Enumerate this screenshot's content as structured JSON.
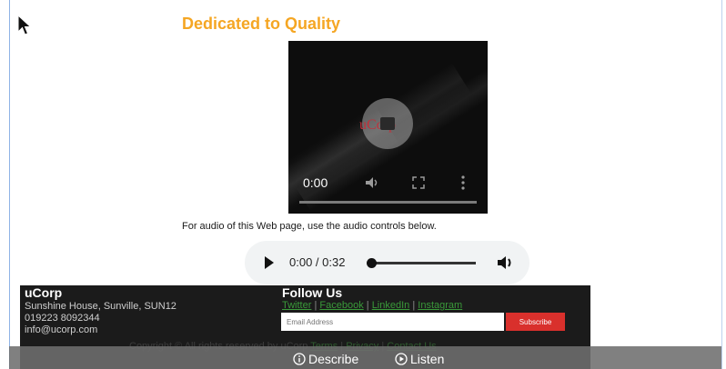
{
  "page": {
    "heading": "Dedicated to Quality",
    "audio_note": "For audio of this Web page, use the audio controls below."
  },
  "video": {
    "logo_text": "uCorp",
    "time": "0:00"
  },
  "audio_player": {
    "time": "0:00 / 0:32",
    "progress": 0
  },
  "footer": {
    "company_name": "uCorp",
    "address_lines": [
      "Sunshine House, Sunville, SUN12",
      "019223 8092344",
      "info@ucorp.com"
    ],
    "follow_title": "Follow Us",
    "social_links": [
      "Twitter",
      "Facebook",
      "LinkedIn",
      "Instagram"
    ],
    "separator": "|",
    "email_placeholder": "Email Address",
    "subscribe_label": "Subscribe",
    "copyright_text": "Copyright © All rights reserved by uCorp",
    "legal_links": [
      "Terms",
      "Privacy",
      "Contact Us"
    ]
  },
  "accessibility_bar": {
    "describe_label": "Describe",
    "listen_label": "Listen"
  },
  "colors": {
    "heading": "#f5a623",
    "subscribe": "#d9302c",
    "logo": "#c0303a",
    "link": "#3a9a3a"
  },
  "icons": [
    "cursor-icon",
    "play-icon",
    "volume-icon",
    "fullscreen-icon",
    "more-icon",
    "speaker-icon",
    "info-icon",
    "play-circle-icon"
  ]
}
